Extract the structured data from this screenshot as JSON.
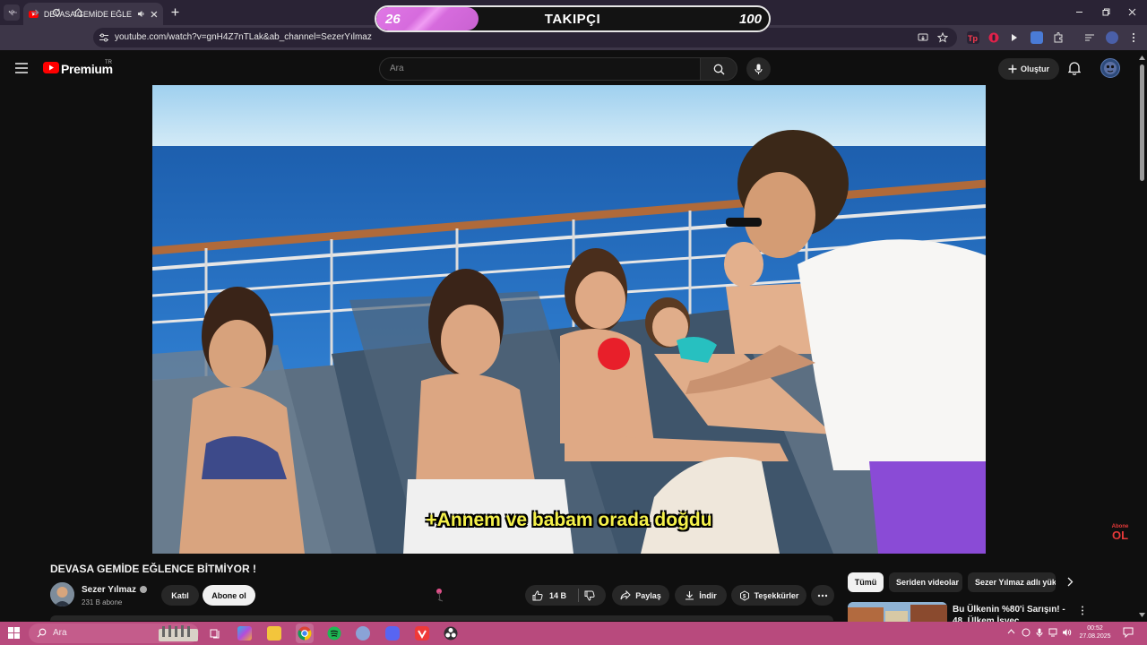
{
  "browser": {
    "tab_title": "DEVASA GEMİDE EĞLENCE BİTMİYOR !",
    "url": "youtube.com/watch?v=gnH4Z7nTLak&ab_channel=SezerYılmaz"
  },
  "overlay": {
    "current": "26",
    "label": "TAKIPÇI",
    "goal": "100",
    "progress": 0.26
  },
  "youtube": {
    "logo": "Premium",
    "region": "TR",
    "search_placeholder": "Ara",
    "create_label": "Oluştur"
  },
  "video": {
    "subtitle": "+Annem ve babam orada doğdu",
    "badge_small": "Abone",
    "badge_big": "OL",
    "title": "DEVASA GEMİDE EĞLENCE BİTMİYOR !"
  },
  "channel": {
    "name": "Sezer Yılmaz",
    "subscribers": "231 B abone",
    "join_label": "Katıl",
    "subscribe_label": "Abone ol"
  },
  "actions": {
    "likes": "14 B",
    "share": "Paylaş",
    "download": "İndir",
    "thanks": "Teşekkürler"
  },
  "chips": {
    "all": "Tümü",
    "series": "Seriden videolar",
    "related": "Sezer Yılmaz adlı yük"
  },
  "recommendation": {
    "title": "Bu Ülkenin %80'i Sarışın! - 48. Ülkem İsveç"
  },
  "taskbar": {
    "search_placeholder": "Ara",
    "time": "00:52",
    "date": "27.08.2025"
  },
  "colors": {
    "accent_pink": "#d66bdd",
    "youtube_red": "#ff0000",
    "subtitle_yellow": "#f5f14a",
    "taskbar": "#b84a7d"
  }
}
